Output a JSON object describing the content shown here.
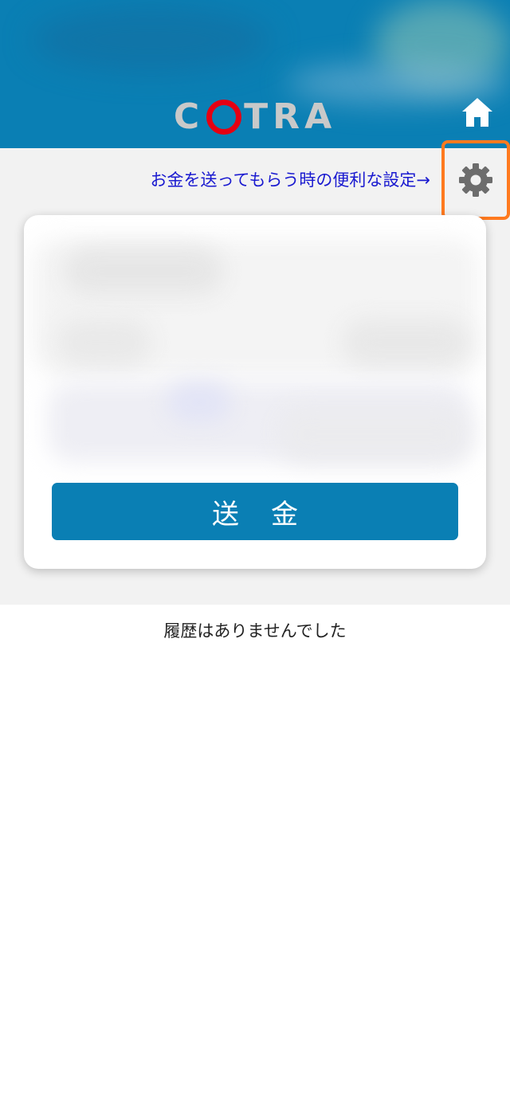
{
  "header": {
    "logo_text_left": "C",
    "logo_text_right": "TRA",
    "logo_alt": "COTRA",
    "home_icon": "home-icon"
  },
  "settings": {
    "link_label": "お金を送ってもらう時の便利な設定→",
    "gear_icon": "gear-icon"
  },
  "card": {
    "send_label": "送金"
  },
  "history": {
    "empty_message": "履歴はありませんでした"
  },
  "colors": {
    "brand_blue": "#0a7fb4",
    "logo_red": "#e50012",
    "highlight_orange": "#ff7a1f",
    "link_blue": "#1a1ad0"
  }
}
